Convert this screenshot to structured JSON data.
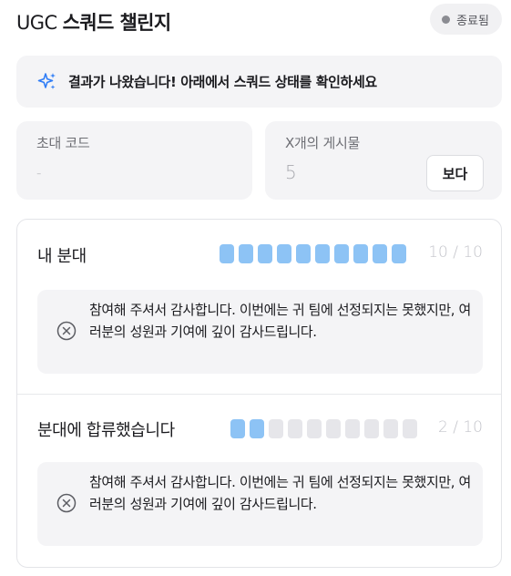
{
  "header": {
    "title_prefix": "UGC",
    "title_main": "스쿼드 챌린지",
    "status_label": "종료됨"
  },
  "banner": {
    "icon": "sparkle-icon",
    "message": "결과가 나왔습니다! 아래에서 스쿼드 상태를 확인하세요"
  },
  "invite_card": {
    "label": "초대 코드",
    "value": "-"
  },
  "posts_card": {
    "label": "X개의 게시물",
    "value": "5",
    "button_label": "보다"
  },
  "squads": [
    {
      "title": "내 분대",
      "filled": 10,
      "total": 10,
      "count_text": "10 / 10",
      "notice_icon": "close-circle-icon",
      "notice": "참여해 주셔서 감사합니다. 이번에는 귀 팀에 선정되지는 못했지만, 여러분의 성원과 기여에 깊이 감사드립니다."
    },
    {
      "title": "분대에 합류했습니다",
      "filled": 2,
      "total": 10,
      "count_text": "2 / 10",
      "notice_icon": "close-circle-icon",
      "notice": "참여해 주셔서 감사합니다. 이번에는 귀 팀에 선정되지는 못했지만, 여러분의 성원과 기여에 깊이 감사드립니다."
    }
  ],
  "colors": {
    "progress_filled": "#8dc3f5",
    "progress_empty": "#e6e6ea",
    "accent_icon": "#2f7df6"
  }
}
